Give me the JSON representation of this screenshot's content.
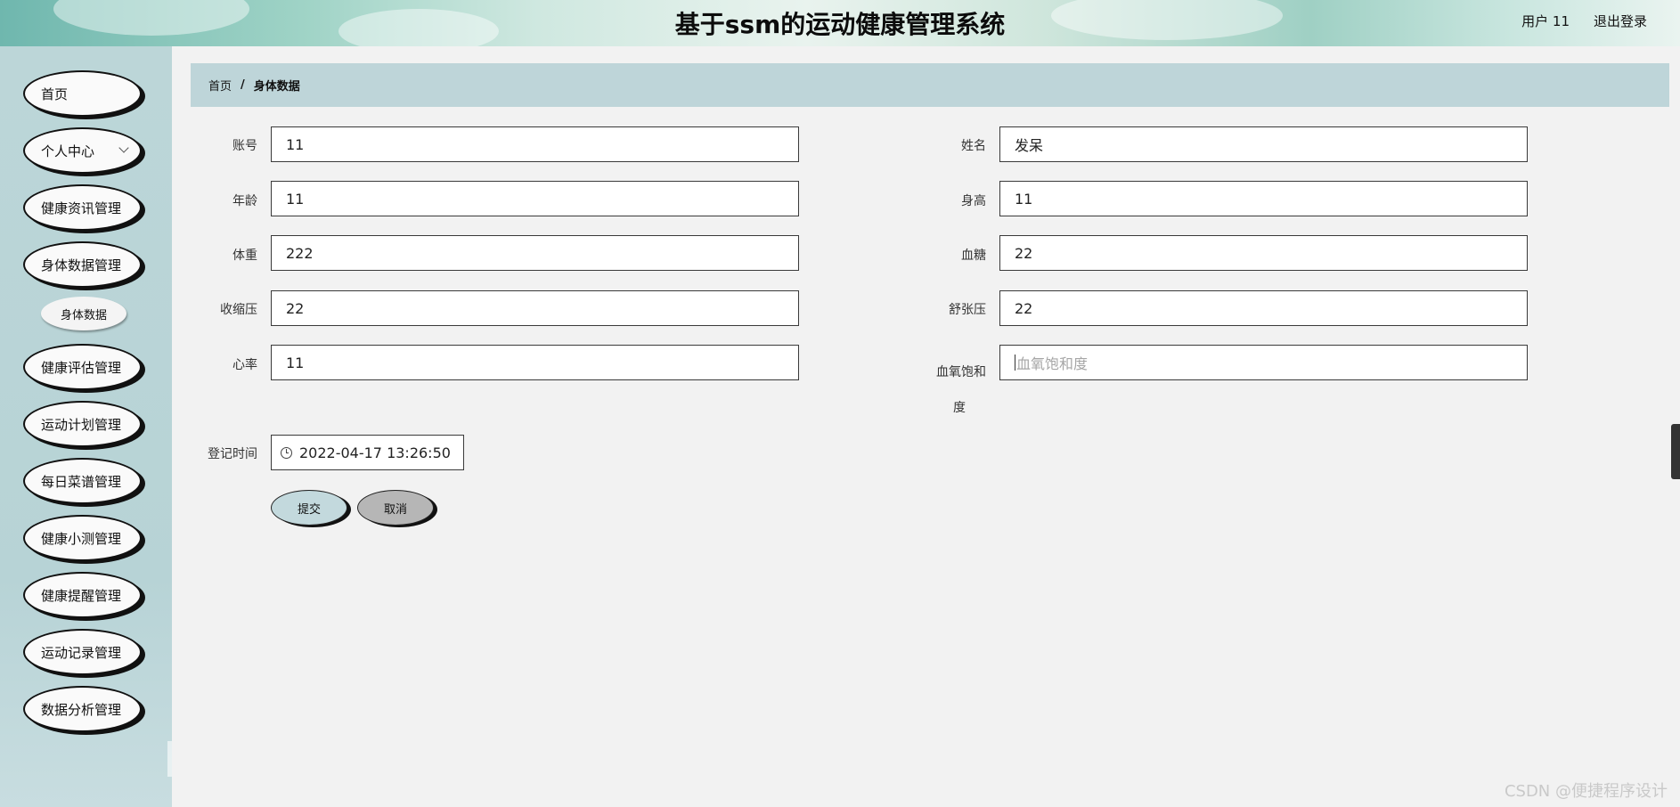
{
  "header": {
    "title": "基于ssm的运动健康管理系统",
    "user": "用户 11",
    "logout": "退出登录"
  },
  "sidebar": {
    "items": [
      {
        "label": "首页"
      },
      {
        "label": "个人中心",
        "has_dropdown": true
      },
      {
        "label": "健康资讯管理"
      },
      {
        "label": "身体数据管理"
      },
      {
        "label": "身体数据",
        "sub": true
      },
      {
        "label": "健康评估管理"
      },
      {
        "label": "运动计划管理"
      },
      {
        "label": "每日菜谱管理"
      },
      {
        "label": "健康小测管理"
      },
      {
        "label": "健康提醒管理"
      },
      {
        "label": "运动记录管理"
      },
      {
        "label": "数据分析管理"
      }
    ]
  },
  "breadcrumb": {
    "home": "首页",
    "separator": "/",
    "current": "身体数据"
  },
  "form": {
    "account": {
      "label": "账号",
      "value": "11"
    },
    "name": {
      "label": "姓名",
      "value": "发呆"
    },
    "age": {
      "label": "年龄",
      "value": "11"
    },
    "height": {
      "label": "身高",
      "value": "11"
    },
    "weight": {
      "label": "体重",
      "value": "222"
    },
    "blood_sugar": {
      "label": "血糖",
      "value": "22"
    },
    "systolic": {
      "label": "收缩压",
      "value": "22"
    },
    "diastolic": {
      "label": "舒张压",
      "value": "22"
    },
    "heart_rate": {
      "label": "心率",
      "value": "11"
    },
    "spo2": {
      "label_line1": "血氧饱和",
      "label_line2": "度",
      "value": "",
      "placeholder": "血氧饱和度"
    },
    "register_time": {
      "label": "登记时间",
      "value": "2022-04-17 13:26:50"
    }
  },
  "buttons": {
    "submit": "提交",
    "cancel": "取消"
  },
  "watermark": "CSDN @便捷程序设计",
  "colors": {
    "sidebar_bg": "#bcd6d8",
    "breadcrumb_bg": "#bed5d9",
    "submit_bg": "#c3d9dd",
    "cancel_bg": "#b6b6b6"
  }
}
